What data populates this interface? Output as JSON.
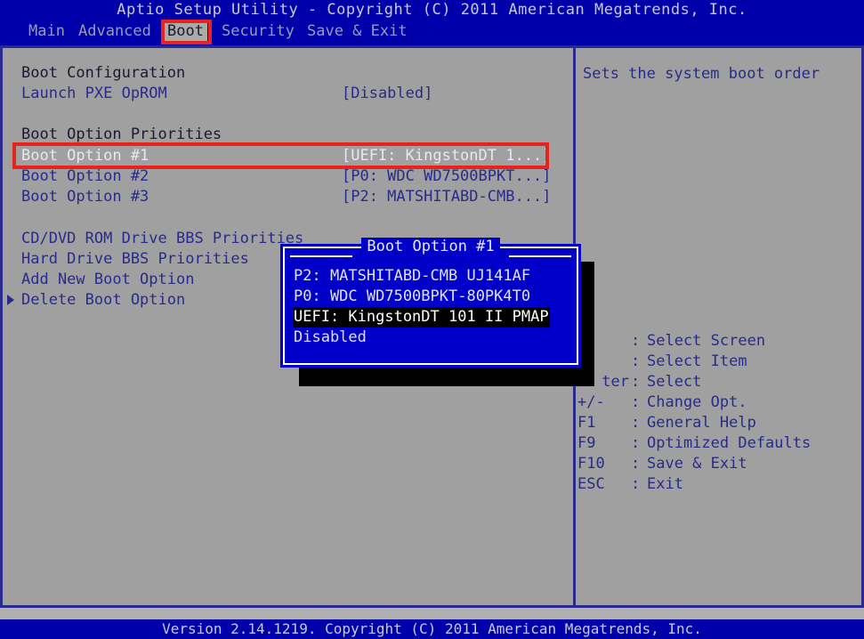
{
  "window": {
    "title": "Aptio Setup Utility - Copyright (C) 2011 American Megatrends, Inc.",
    "version_bar": "Version 2.14.1219. Copyright (C) 2011 American Megatrends, Inc."
  },
  "menu": {
    "items": [
      {
        "label": "Main",
        "active": false
      },
      {
        "label": "Advanced",
        "active": false
      },
      {
        "label": "Boot",
        "active": true
      },
      {
        "label": "Security",
        "active": false
      },
      {
        "label": "Save & Exit",
        "active": false
      }
    ]
  },
  "left_pane": {
    "rows": [
      {
        "label": "Boot Configuration",
        "value": "",
        "style": "head",
        "arrow": false
      },
      {
        "label": "Launch PXE OpROM",
        "value": "[Disabled]",
        "style": "item",
        "arrow": false
      },
      {
        "label": "",
        "value": "",
        "style": "item",
        "arrow": false
      },
      {
        "label": "Boot Option Priorities",
        "value": "",
        "style": "head",
        "arrow": false
      },
      {
        "label": "Boot Option #1",
        "value": "[UEFI: KingstonDT 1...]",
        "style": "sel",
        "arrow": false
      },
      {
        "label": "Boot Option #2",
        "value": "[P0: WDC WD7500BPKT...]",
        "style": "item",
        "arrow": false
      },
      {
        "label": "Boot Option #3",
        "value": "[P2: MATSHITABD-CMB...]",
        "style": "item",
        "arrow": false
      },
      {
        "label": "",
        "value": "",
        "style": "item",
        "arrow": false
      },
      {
        "label": "CD/DVD ROM Drive BBS Priorities",
        "value": "",
        "style": "item",
        "arrow": false
      },
      {
        "label": "Hard Drive BBS Priorities",
        "value": "",
        "style": "item",
        "arrow": false
      },
      {
        "label": "Add New Boot Option",
        "value": "",
        "style": "item",
        "arrow": false
      },
      {
        "label": "Delete Boot Option",
        "value": "",
        "style": "item",
        "arrow": true
      }
    ]
  },
  "right_pane": {
    "help_text": "Sets the system boot order",
    "legend": [
      {
        "key": "",
        "desc": "Select Screen"
      },
      {
        "key": "",
        "desc": "Select Item"
      },
      {
        "key": "ter",
        "desc": "Select"
      },
      {
        "key": "+/-",
        "desc": "Change Opt."
      },
      {
        "key": "F1",
        "desc": "General Help"
      },
      {
        "key": "F9",
        "desc": "Optimized Defaults"
      },
      {
        "key": "F10",
        "desc": "Save & Exit"
      },
      {
        "key": "ESC",
        "desc": "Exit"
      }
    ]
  },
  "popup": {
    "title": "Boot Option #1",
    "options": [
      {
        "label": "P2: MATSHITABD-CMB UJ141AF",
        "selected": false
      },
      {
        "label": "P0: WDC WD7500BPKT-80PK4T0",
        "selected": false
      },
      {
        "label": "UEFI: KingstonDT 101 II PMAP",
        "selected": true
      },
      {
        "label": "Disabled",
        "selected": false
      }
    ]
  },
  "annotations": {
    "boot_tab_box": "red-rectangle-around-boot-tab",
    "boot_option_1_box": "red-rectangle-around-boot-option-1-row"
  },
  "colors": {
    "background_blue": "#0000ab",
    "panel_gray": "#a0a0a0",
    "item_blue": "#2a2a8c",
    "selected_light": "#e8e8f0",
    "annotation_red": "#e8221c",
    "popup_blue": "#0000c8",
    "highlight_black": "#000000"
  }
}
